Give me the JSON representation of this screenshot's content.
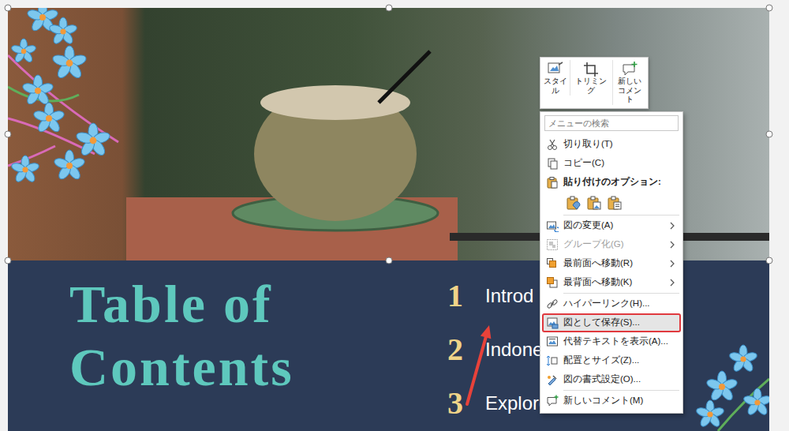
{
  "slide": {
    "title": "Table of Contents",
    "toc": [
      {
        "number": "1",
        "label": "Introd"
      },
      {
        "number": "2",
        "label": "Indone"
      },
      {
        "number": "3",
        "label": "Explore Destinations"
      }
    ]
  },
  "mini_toolbar": {
    "buttons": [
      {
        "label": "スタイル"
      },
      {
        "label": "トリミング"
      },
      {
        "label": "新しいコメント"
      }
    ]
  },
  "context_menu": {
    "search": {
      "placeholder": "メニューの検索"
    },
    "groups": [
      {
        "items": [
          {
            "kind": "command",
            "label": "切り取り(T)",
            "submenu": false,
            "disabled": false,
            "selected": false
          },
          {
            "kind": "command",
            "label": "コピー(C)",
            "submenu": false,
            "disabled": false,
            "selected": false
          },
          {
            "kind": "header",
            "label": "貼り付けのオプション:",
            "submenu": false,
            "disabled": false,
            "selected": false
          },
          {
            "kind": "paste",
            "submenu": false,
            "disabled": false,
            "selected": false,
            "options": [
              {
                "selected": false
              },
              {
                "selected": false
              },
              {
                "selected": false
              }
            ]
          }
        ]
      },
      {
        "items": [
          {
            "kind": "command",
            "label": "図の変更(A)",
            "submenu": true,
            "disabled": false,
            "selected": false
          },
          {
            "kind": "command",
            "label": "グループ化(G)",
            "submenu": true,
            "disabled": true,
            "selected": false
          },
          {
            "kind": "command",
            "label": "最前面へ移動(R)",
            "submenu": true,
            "disabled": false,
            "selected": false
          },
          {
            "kind": "command",
            "label": "最背面へ移動(K)",
            "submenu": true,
            "disabled": false,
            "selected": false
          }
        ]
      },
      {
        "items": [
          {
            "kind": "command",
            "label": "ハイパーリンク(H)...",
            "submenu": false,
            "disabled": false,
            "selected": false
          },
          {
            "kind": "command",
            "label": "図として保存(S)...",
            "submenu": false,
            "disabled": false,
            "selected": true
          },
          {
            "kind": "command",
            "label": "代替テキストを表示(A)...",
            "submenu": false,
            "disabled": false,
            "selected": false
          },
          {
            "kind": "command",
            "label": "配置とサイズ(Z)...",
            "submenu": false,
            "disabled": false,
            "selected": false
          },
          {
            "kind": "command",
            "label": "図の書式設定(O)...",
            "submenu": false,
            "disabled": false,
            "selected": false
          }
        ]
      },
      {
        "items": [
          {
            "kind": "command",
            "label": "新しいコメント(M)",
            "submenu": false,
            "disabled": false,
            "selected": false
          }
        ]
      }
    ]
  }
}
